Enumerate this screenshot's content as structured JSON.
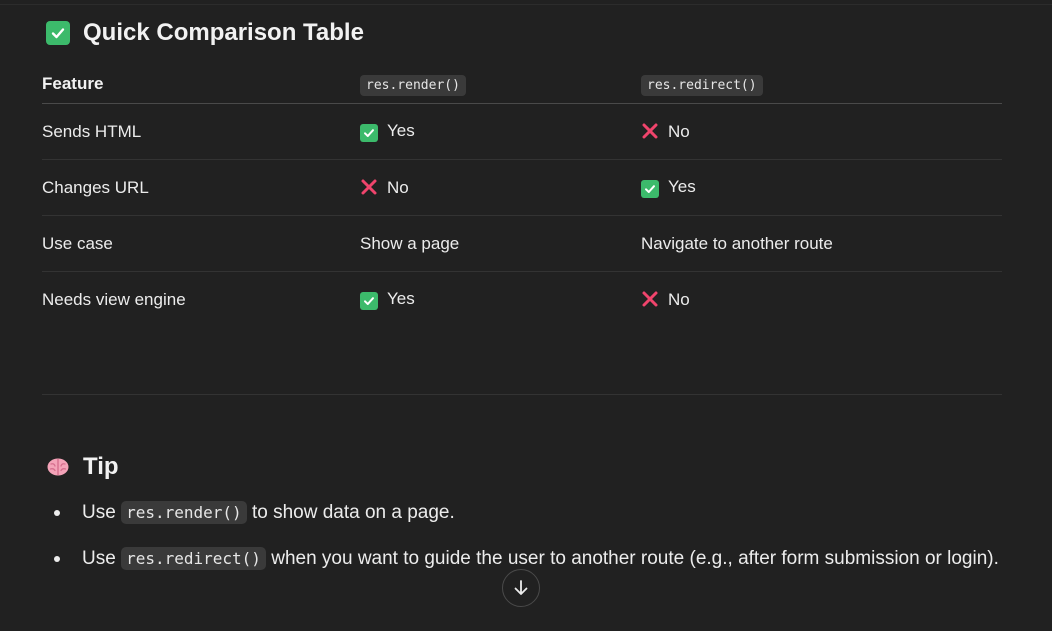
{
  "section_title": "Quick Comparison Table",
  "table": {
    "headers": [
      "Feature",
      "res.render()",
      "res.redirect()"
    ],
    "rows": [
      {
        "feature": "Sends HTML",
        "render": {
          "icon": "check-icon",
          "text": "Yes"
        },
        "redirect": {
          "icon": "cross-icon",
          "text": "No"
        }
      },
      {
        "feature": "Changes URL",
        "render": {
          "icon": "cross-icon",
          "text": "No"
        },
        "redirect": {
          "icon": "check-icon",
          "text": "Yes"
        }
      },
      {
        "feature": "Use case",
        "render": {
          "icon": "",
          "text": "Show a page"
        },
        "redirect": {
          "icon": "",
          "text": "Navigate to another route"
        }
      },
      {
        "feature": "Needs view engine",
        "render": {
          "icon": "check-icon",
          "text": "Yes"
        },
        "redirect": {
          "icon": "cross-icon",
          "text": "No"
        }
      }
    ]
  },
  "tip": {
    "title": "Tip",
    "items": [
      {
        "prefix": "Use ",
        "code": "res.render()",
        "suffix": " to show data on a page."
      },
      {
        "prefix": "Use ",
        "code": "res.redirect()",
        "suffix": " when you want to guide the user to another route (e.g., after form submission or login)."
      }
    ]
  },
  "colors": {
    "background": "#212121",
    "check_green": "#3cba6b",
    "cross_red": "#f0446c",
    "code_bg": "#3a3a3a"
  },
  "icons": {
    "heading_icon": "check-mark-button-icon",
    "tip_icon": "brain-icon",
    "scroll_icon": "arrow-down-icon"
  }
}
